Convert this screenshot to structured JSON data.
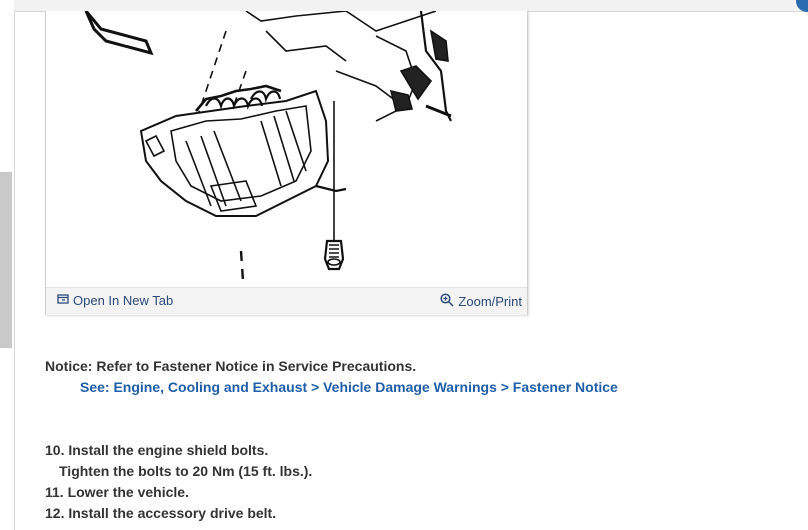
{
  "figure": {
    "open_tab_label": "Open In New Tab",
    "zoom_label": "Zoom/Print"
  },
  "notice": {
    "text": "Notice: Refer to Fastener Notice in Service Precautions.",
    "see_link": "See: Engine, Cooling and Exhaust > Vehicle Damage Warnings > Fastener Notice"
  },
  "steps": [
    "10. Install the engine shield bolts.",
    "Tighten the bolts to 20 Nm (15 ft. lbs.).",
    "11. Lower the vehicle.",
    "12. Install the accessory drive belt."
  ],
  "colors": {
    "link": "#1f5ea8",
    "bar_link": "#2c4a7a",
    "accent": "#2b6cb0"
  },
  "icons": [
    "open-new-tab-icon",
    "zoom-icon"
  ]
}
